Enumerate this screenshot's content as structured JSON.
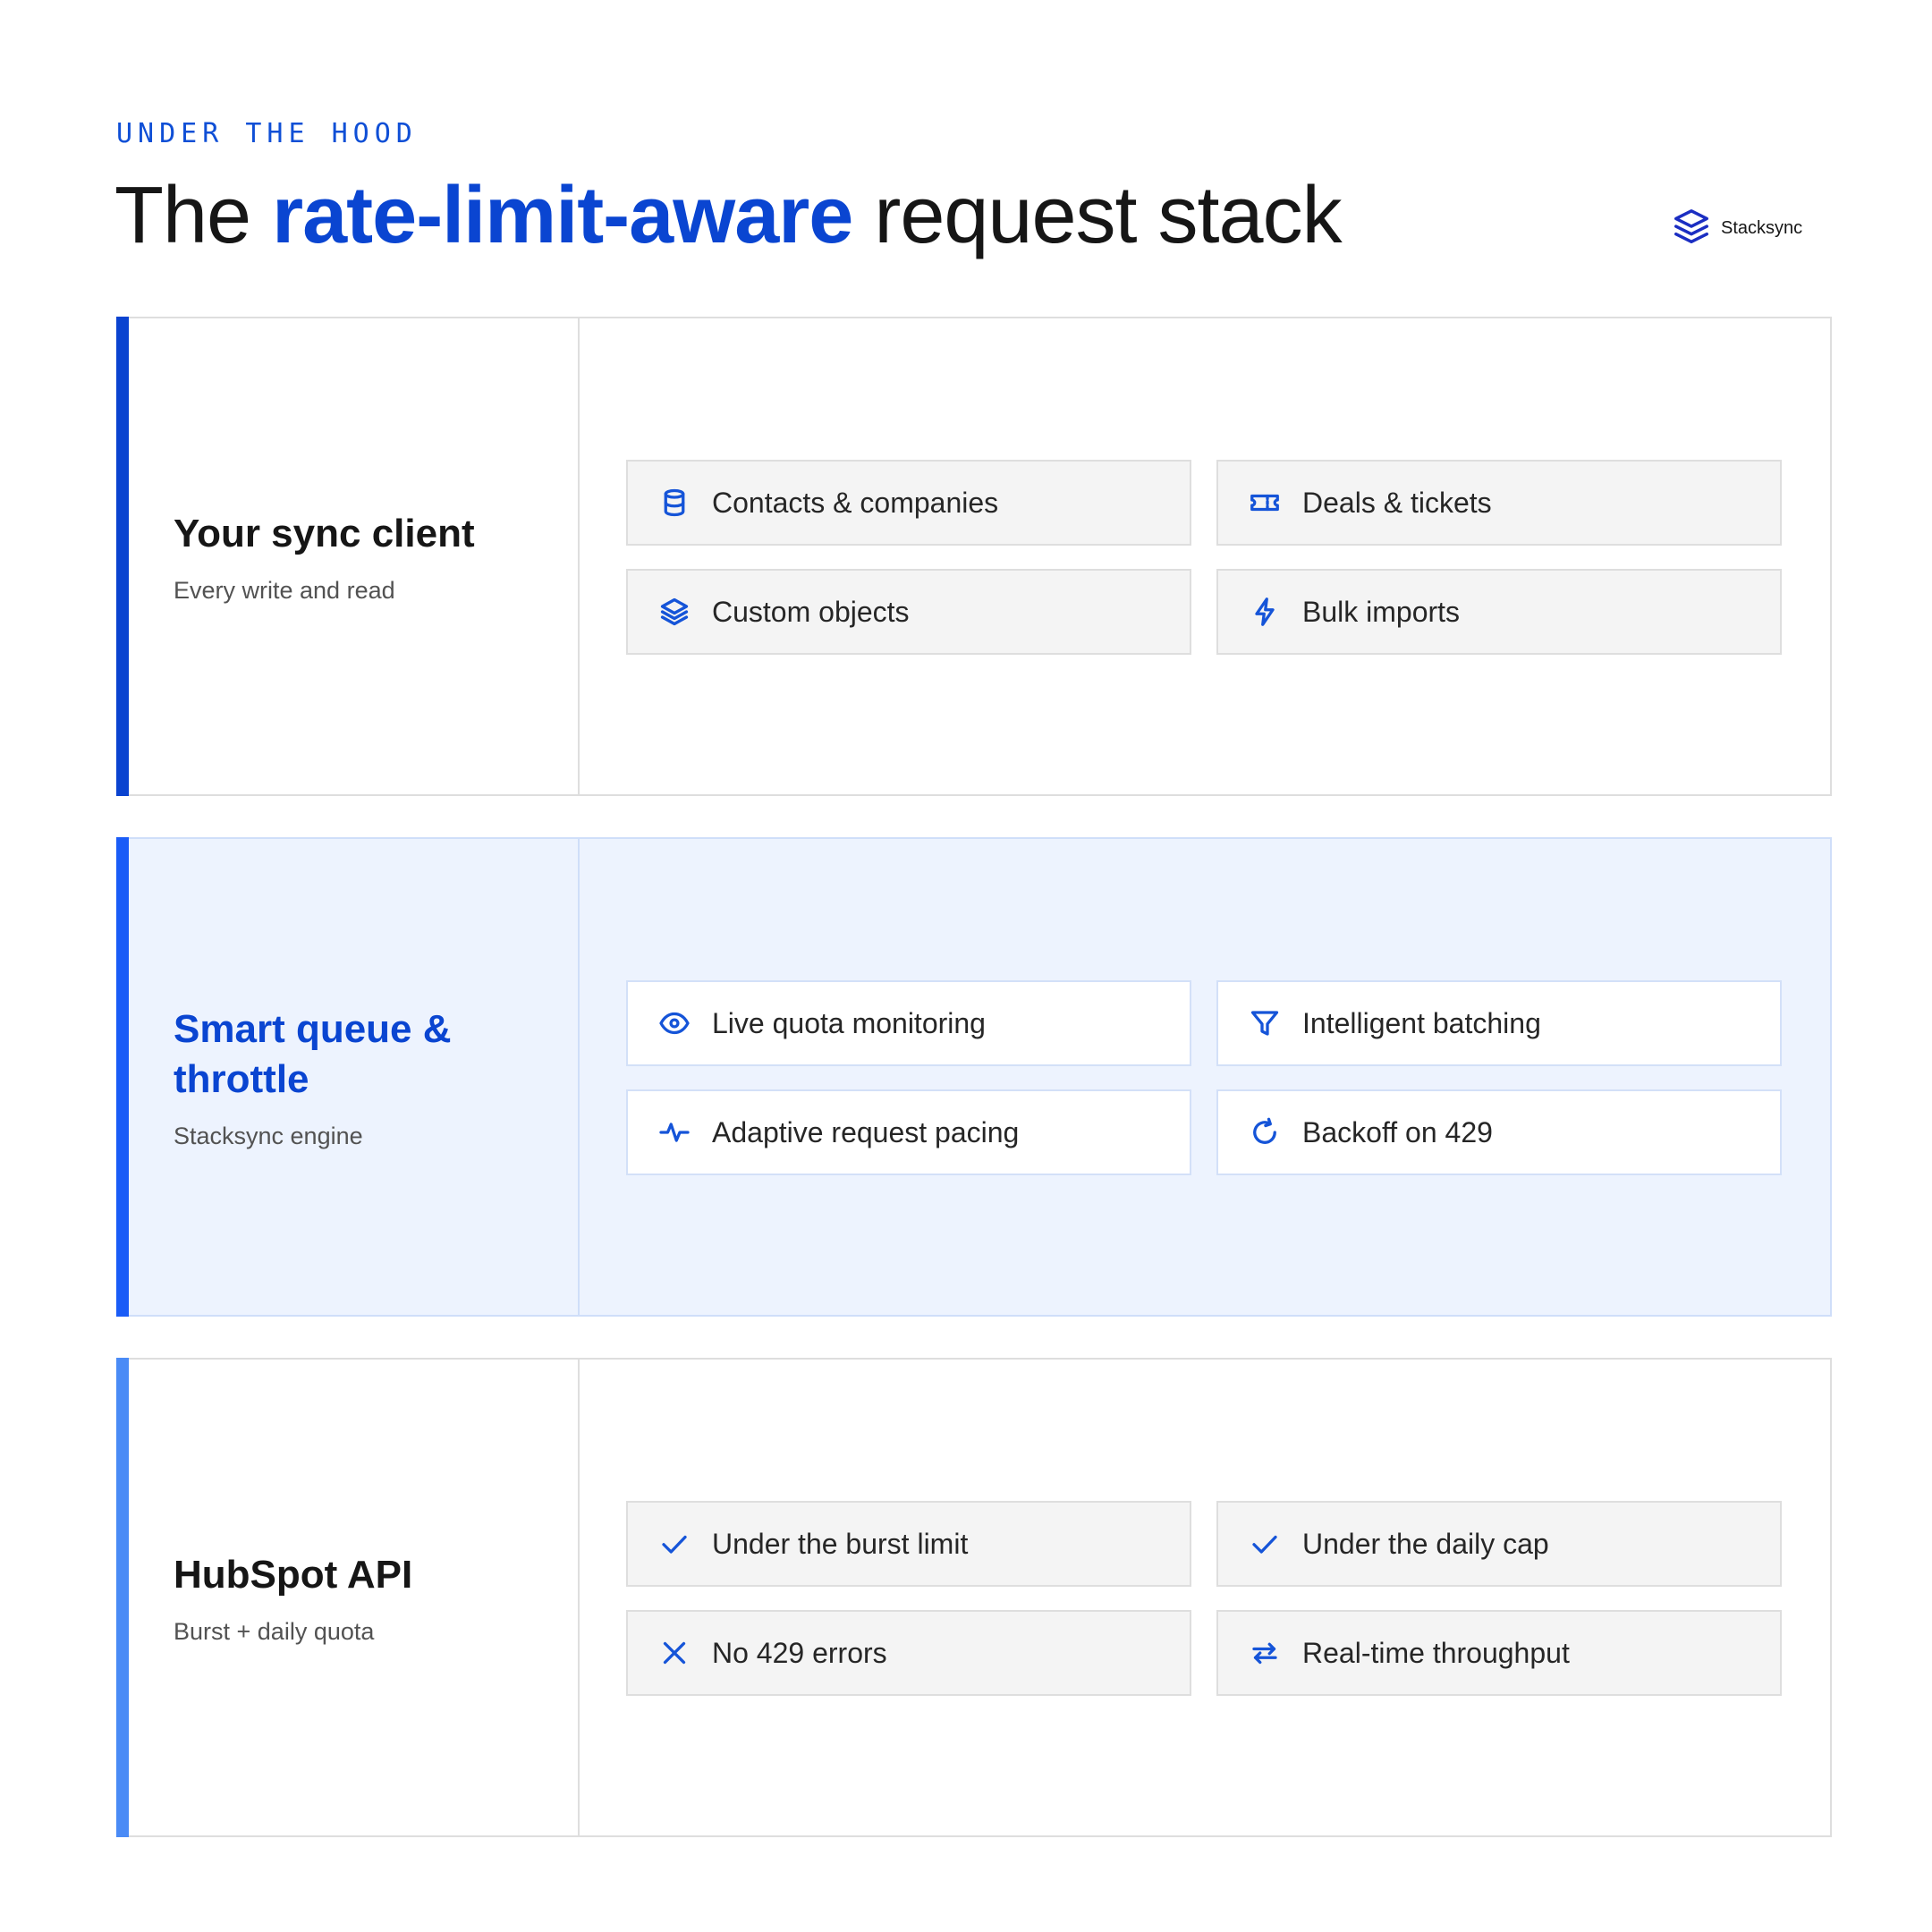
{
  "header": {
    "eyebrow": "UNDER THE HOOD",
    "title_pre": "The ",
    "title_highlight": "rate-limit-aware",
    "title_post": " request stack",
    "logo_text": "Stacksync"
  },
  "colors": {
    "accent": "#0a45d1",
    "bar_top": "#0a43d0",
    "bar_mid": "#1a5cf7",
    "bar_bottom": "#4a8bf6",
    "mid_background": "#edf3fe"
  },
  "layers": [
    {
      "title": "Your sync client",
      "subtitle": "Every write and read",
      "cards": [
        {
          "label": "Contacts & companies",
          "icon": "database-icon"
        },
        {
          "label": "Deals & tickets",
          "icon": "ticket-icon"
        },
        {
          "label": "Custom objects",
          "icon": "layers-icon"
        },
        {
          "label": "Bulk imports",
          "icon": "lightning-icon"
        }
      ]
    },
    {
      "title": "Smart queue & throttle",
      "subtitle": "Stacksync engine",
      "cards": [
        {
          "label": "Live quota monitoring",
          "icon": "eye-icon"
        },
        {
          "label": "Intelligent batching",
          "icon": "filter-icon"
        },
        {
          "label": "Adaptive request pacing",
          "icon": "pulse-icon"
        },
        {
          "label": "Backoff on 429",
          "icon": "refresh-icon"
        }
      ]
    },
    {
      "title": "HubSpot API",
      "subtitle": "Burst + daily quota",
      "cards": [
        {
          "label": "Under the burst limit",
          "icon": "check-icon"
        },
        {
          "label": "Under the daily cap",
          "icon": "check-icon"
        },
        {
          "label": "No 429 errors",
          "icon": "close-icon"
        },
        {
          "label": "Real-time throughput",
          "icon": "swap-arrows-icon"
        }
      ]
    }
  ]
}
